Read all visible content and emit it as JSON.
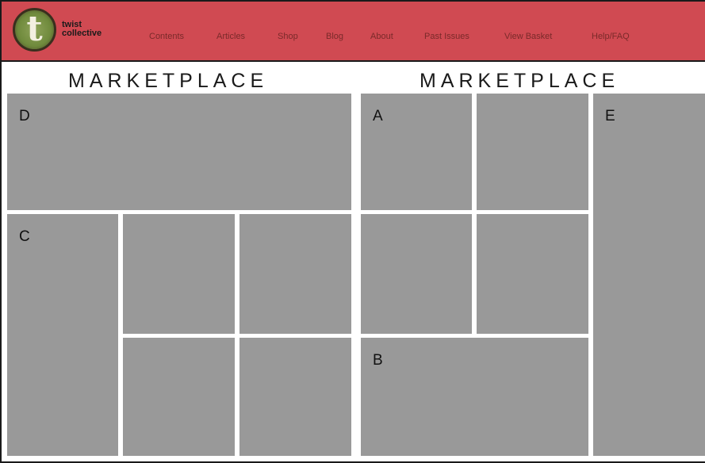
{
  "brand": {
    "line1": "twist",
    "line2": "collective",
    "logo_letter": "t"
  },
  "nav": [
    "Contents",
    "Articles",
    "Shop",
    "Blog",
    "About",
    "Past Issues",
    "View Basket",
    "Help/FAQ"
  ],
  "headings": {
    "left": "MARKETPLACE",
    "right": "MARKETPLACE"
  },
  "slots": {
    "d": "D",
    "a": "A",
    "e": "E",
    "c": "C",
    "b": "B"
  },
  "colors": {
    "navbar": "#d04a52",
    "box": "#999999",
    "nav_text": "#7a2a2a"
  }
}
